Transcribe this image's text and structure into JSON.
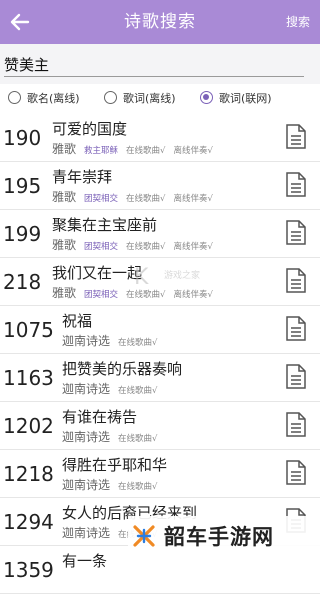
{
  "header": {
    "title": "诗歌搜索",
    "search_label": "搜索"
  },
  "search": {
    "value": "赞美主",
    "placeholder": ""
  },
  "options": [
    {
      "label": "歌名(离线)",
      "selected": false
    },
    {
      "label": "歌词(离线)",
      "selected": false
    },
    {
      "label": "歌词(联网)",
      "selected": true
    }
  ],
  "results": [
    {
      "number": "190",
      "title": "可爱的国度",
      "book": "雅歌",
      "chip": "救主耶稣",
      "tags": [
        "在线歌曲√",
        "离线伴奏√"
      ]
    },
    {
      "number": "195",
      "title": "青年崇拜",
      "book": "雅歌",
      "chip": "团契相交",
      "tags": [
        "在线歌曲√",
        "离线伴奏√"
      ]
    },
    {
      "number": "199",
      "title": "聚集在主宝座前",
      "book": "雅歌",
      "chip": "团契相交",
      "tags": [
        "在线歌曲√",
        "离线伴奏√"
      ]
    },
    {
      "number": "218",
      "title": "我们又在一起",
      "book": "雅歌",
      "chip": "团契相交",
      "tags": [
        "在线歌曲√",
        "离线伴奏√"
      ]
    },
    {
      "number": "1075",
      "title": "祝福",
      "book": "迦南诗选",
      "chip": "",
      "tags": [
        "在线歌曲√"
      ]
    },
    {
      "number": "1163",
      "title": "把赞美的乐器奏响",
      "book": "迦南诗选",
      "chip": "",
      "tags": [
        "在线歌曲√"
      ]
    },
    {
      "number": "1202",
      "title": "有谁在祷告",
      "book": "迦南诗选",
      "chip": "",
      "tags": [
        "在线歌曲√"
      ]
    },
    {
      "number": "1218",
      "title": "得胜在乎耶和华",
      "book": "迦南诗选",
      "chip": "",
      "tags": [
        "在线歌曲√"
      ]
    },
    {
      "number": "1294",
      "title": "女人的后裔已经来到",
      "book": "迦南诗选",
      "chip": "",
      "tags": [
        "在线歌曲√"
      ]
    },
    {
      "number": "1359",
      "title": "有一条",
      "book": "",
      "chip": "",
      "tags": []
    }
  ],
  "watermark": {
    "text": "游戏之家"
  },
  "brand": {
    "text": "韶车手游网"
  },
  "colors": {
    "accent": "#a98ad6",
    "radio": "#7b61b8"
  }
}
